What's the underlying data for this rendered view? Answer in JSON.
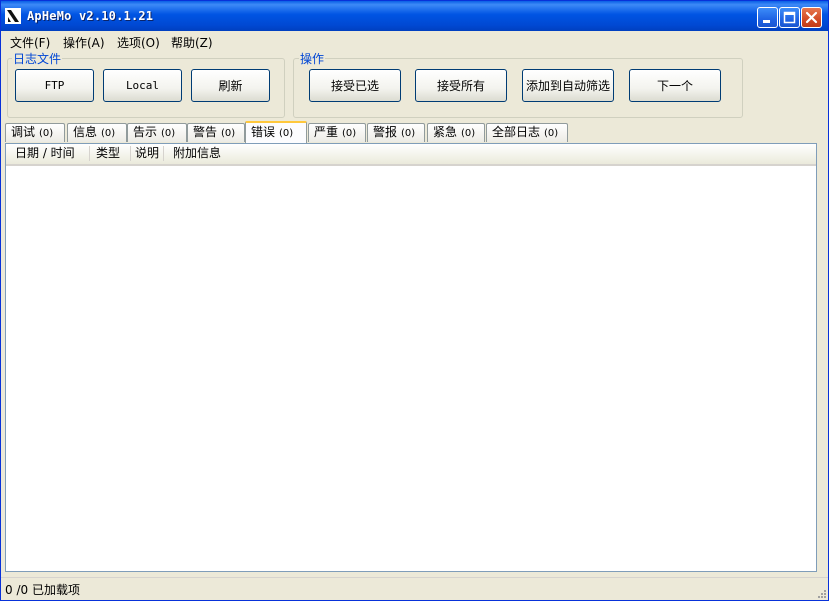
{
  "window": {
    "title": "ApHeMo v2.10.1.21",
    "icon": "aphemo-app-icon",
    "caption_buttons": [
      "minimize-icon",
      "maximize-icon",
      "close-icon"
    ]
  },
  "menu": {
    "items": [
      "文件(F)",
      "操作(A)",
      "选项(O)",
      "帮助(Z)"
    ]
  },
  "groups": {
    "logfile": {
      "title": "日志文件",
      "buttons": [
        "FTP",
        "Local",
        "刷新"
      ]
    },
    "actions": {
      "title": "操作",
      "buttons": [
        "接受已选",
        "接受所有",
        "添加到自动筛选",
        "下一个"
      ]
    }
  },
  "tabs": {
    "active_index": 4,
    "items": [
      {
        "label": "调试",
        "count": "(0)"
      },
      {
        "label": "信息",
        "count": "(0)"
      },
      {
        "label": "告示",
        "count": "(0)"
      },
      {
        "label": "警告",
        "count": "(0)"
      },
      {
        "label": "错误",
        "count": "(0)"
      },
      {
        "label": "严重",
        "count": "(0)"
      },
      {
        "label": "警报",
        "count": "(0)"
      },
      {
        "label": "紧急",
        "count": "(0)"
      },
      {
        "label": "全部日志",
        "count": "(0)"
      }
    ]
  },
  "list": {
    "columns": [
      "日期 / 时间",
      "类型",
      "说明",
      "附加信息"
    ],
    "rows": []
  },
  "status": {
    "text": "0 /0 已加载项"
  },
  "colors": {
    "titlebar": "#0054e3",
    "window_bg": "#ece9d8",
    "group_title": "#0046d5",
    "active_tab_accent": "#ffc83c",
    "close_button": "#d24b25"
  }
}
